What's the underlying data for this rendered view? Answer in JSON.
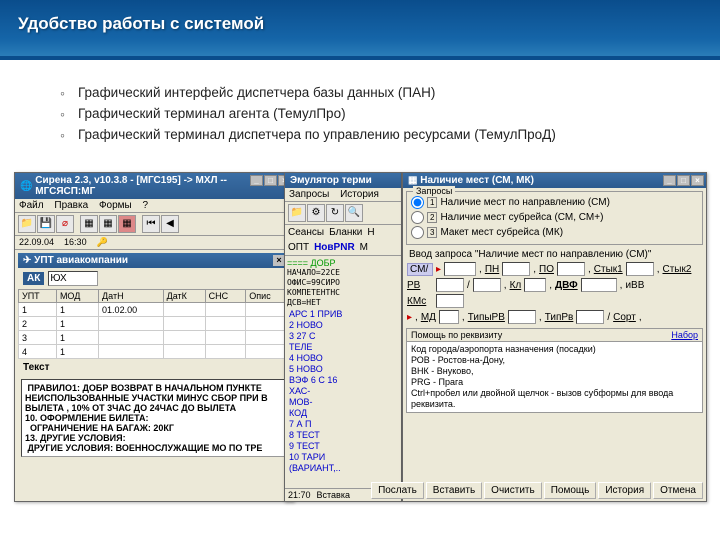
{
  "slide": {
    "title": "Удобство работы с системой",
    "bullets": [
      "Графический интерфейс диспетчера базы данных (ПАН)",
      "Графический терминал агента (ТемулПро)",
      "Графический терминал диспетчера по управлению ресурсами (ТемулПроД)"
    ]
  },
  "w1": {
    "title": "Сирена 2.3, v10.3.8 - [МГС195] -> МХЛ -- МГСЯСП:МГ",
    "menu": [
      "Файл",
      "Правка",
      "Формы",
      "?"
    ],
    "info": {
      "date": "22.09.04",
      "time": "16:30"
    },
    "subtitle": "УПТ авиакомпании",
    "form": {
      "ak_label": "АК",
      "ak_value": "ЮХ"
    },
    "cols": [
      "УПТ",
      "МОД",
      "ДатН",
      "ДатК",
      "СНС",
      "Опис"
    ],
    "rows": [
      [
        "1",
        "1",
        "01.02.00",
        "",
        "",
        ""
      ],
      [
        "2",
        "1",
        "",
        "",
        "",
        ""
      ],
      [
        "3",
        "1",
        "",
        "",
        "",
        ""
      ],
      [
        "4",
        "1",
        "",
        "",
        "",
        ""
      ]
    ],
    "txt_label": "Текст",
    "txt": " ПРАВИЛО1: ДОБР ВОЗВРАТ В НАЧАЛЬНОМ ПУНКТЕ\nНЕИСПОЛЬЗОВАННЫЕ УЧАСТКИ МИНУС СБОР ПРИ В\nВЫЛЕТА , 10% ОТ 3ЧАС ДО 24ЧАС ДО ВЫЛЕТА\n10. ОФОРМЛЕНИЕ БИЛЕТА:\n  ОГРАНИЧЕНИЕ НА БАГАЖ: 20КГ\n13. ДРУГИЕ УСЛОВИЯ:\n ДРУГИЕ УСЛОВИЯ: ВОЕННОСЛУЖАЩИЕ МО ПО ТРЕ"
  },
  "w2": {
    "title": "Эмулятор терми",
    "menu": [
      "Запросы",
      "История"
    ],
    "links": [
      "Сеансы",
      "Бланки",
      "Н"
    ],
    "tabs": [
      "ОПТ",
      "НовPNR",
      "M"
    ],
    "term_green": "==== ДОБР",
    "term_text": "НАЧАЛО=22СЕ\nОФИС=99СИРО\nКОМПЕТЕНТНС\nДСВ=НЕТ",
    "term_items": [
      "АРС 1 ПРИВ",
      "   2 НОВО",
      "   3 27 С",
      "   ТЕЛЕ",
      "   4 НОВО",
      "   5 НОВО",
      "ВЭФ 6 С 16",
      "   ХАС-",
      "   МОВ-",
      "   КОД",
      "   7 А П",
      "   8 ТЕСТ",
      "   9 ТЕСТ",
      "  10 ТАРИ",
      "(ВАРИАНТ,.."
    ],
    "sb": [
      "21:70",
      "Вставка"
    ]
  },
  "w3": {
    "title": "Наличие мест (СМ, МК)",
    "grp1": {
      "title": "Запросы",
      "r1": "Наличие мест по направлению (СМ)",
      "r2": "Наличие мест субрейса (СМ, СМ+)",
      "r3": "Макет мест субрейса (МК)"
    },
    "prompt": "Ввод запроса \"Наличие мест по направлению (СМ)\"",
    "fields": {
      "sm": "СМ/",
      "pn": "ПН",
      "po": "ПО",
      "styk1": "Стык1",
      "styk2": "Стык2",
      "rv": "РВ",
      "kl": "Кл",
      "dvf": "ДВФ",
      "ivv": "иВВ",
      "kms": "КМс",
      "md": "МД",
      "tipyrv": "ТипыРВ",
      "tiprv": "ТипРв",
      "sort": "Сорт"
    },
    "help": {
      "title": "Помощь по реквизиту",
      "link": "Набор",
      "body": "Код города/аэропорта назначения (посадки)\nРОВ - Ростов-на-Дону,\nВНК - Внуково,\nPRG - Прага\nCtrl+пробел или двойной щелчок - вызов субформы для ввода реквизита."
    },
    "buttons": [
      "Послать",
      "Вставить",
      "Очистить",
      "Помощь",
      "История",
      "Отмена"
    ]
  },
  "extra": {
    "val": "9"
  }
}
